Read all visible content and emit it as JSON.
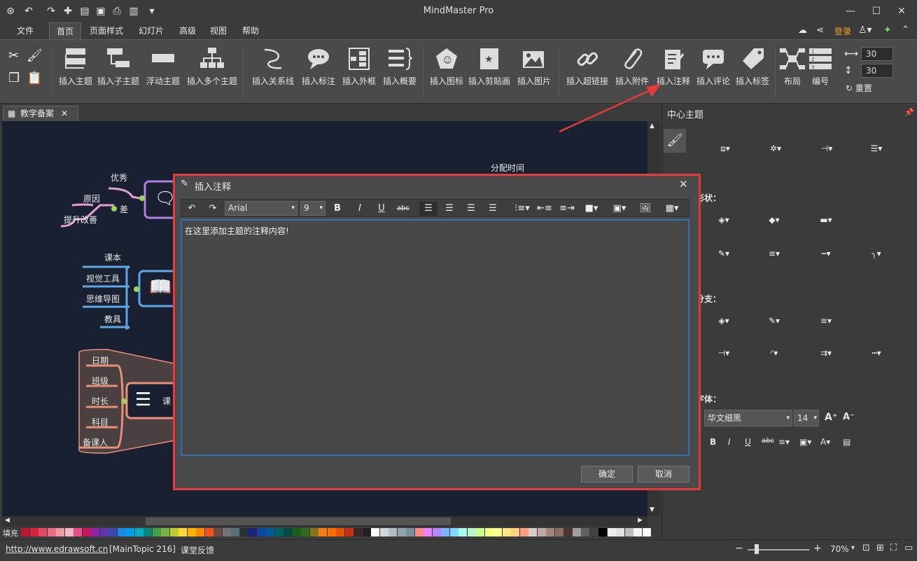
{
  "app": {
    "title": "MindMaster Pro",
    "login": "登录"
  },
  "menu": [
    {
      "label": "文件"
    },
    {
      "label": "首页"
    },
    {
      "label": "页面样式"
    },
    {
      "label": "幻灯片"
    },
    {
      "label": "高级"
    },
    {
      "label": "视图"
    },
    {
      "label": "帮助"
    }
  ],
  "ribbon": {
    "insert_topic": "插入主题",
    "insert_subtopic": "插入子主题",
    "floating_topic": "浮动主题",
    "insert_multi": "插入多个主题",
    "insert_relation": "插入关系线",
    "insert_callout": "插入标注",
    "insert_boundary": "插入外框",
    "insert_summary": "插入概要",
    "insert_icon": "插入图标",
    "insert_clipart": "插入剪贴画",
    "insert_image": "插入图片",
    "insert_hyperlink": "插入超链接",
    "insert_attachment": "插入附件",
    "insert_note": "插入注释",
    "insert_comment": "插入评论",
    "insert_tag": "插入标签",
    "layout": "布局",
    "numbering": "编号",
    "spacing_h": "30",
    "spacing_v": "30",
    "reset": "重置"
  },
  "doc_tab": {
    "label": "教学备案"
  },
  "canvas": {
    "alloc_time": "分配时间",
    "good": "优秀",
    "reason": "原因",
    "bad": "差",
    "improve": "提升改善",
    "textbook": "课本",
    "visual_tools": "视觉工具",
    "mindmap": "思维导图",
    "teaching_aid": "教具",
    "date": "日期",
    "class": "班级",
    "duration": "时长",
    "subject": "科目",
    "preparer": "备课人",
    "lesson_partial": "课"
  },
  "dialog": {
    "title": "插入注释",
    "font": "Arial",
    "font_size": "9",
    "content": "在这里添加主题的注释内容!",
    "ok": "确定",
    "cancel": "取消"
  },
  "panel": {
    "title": "中心主题",
    "shape_label": "形状：",
    "branch_label": "分支：",
    "font_label": "字体：",
    "font_name": "华文细黑",
    "font_size": "14"
  },
  "status": {
    "url": "http://www.edrawsoft.cn",
    "topic": "[MainTopic 216]",
    "topic_name": "课堂反馈",
    "zoom": "70%",
    "fill": "填充"
  },
  "colors": {
    "dialog_border": "#e23b3b",
    "canvas_bg": "#192031",
    "login": "#f0a020",
    "editor_border": "#2f6fb5"
  }
}
